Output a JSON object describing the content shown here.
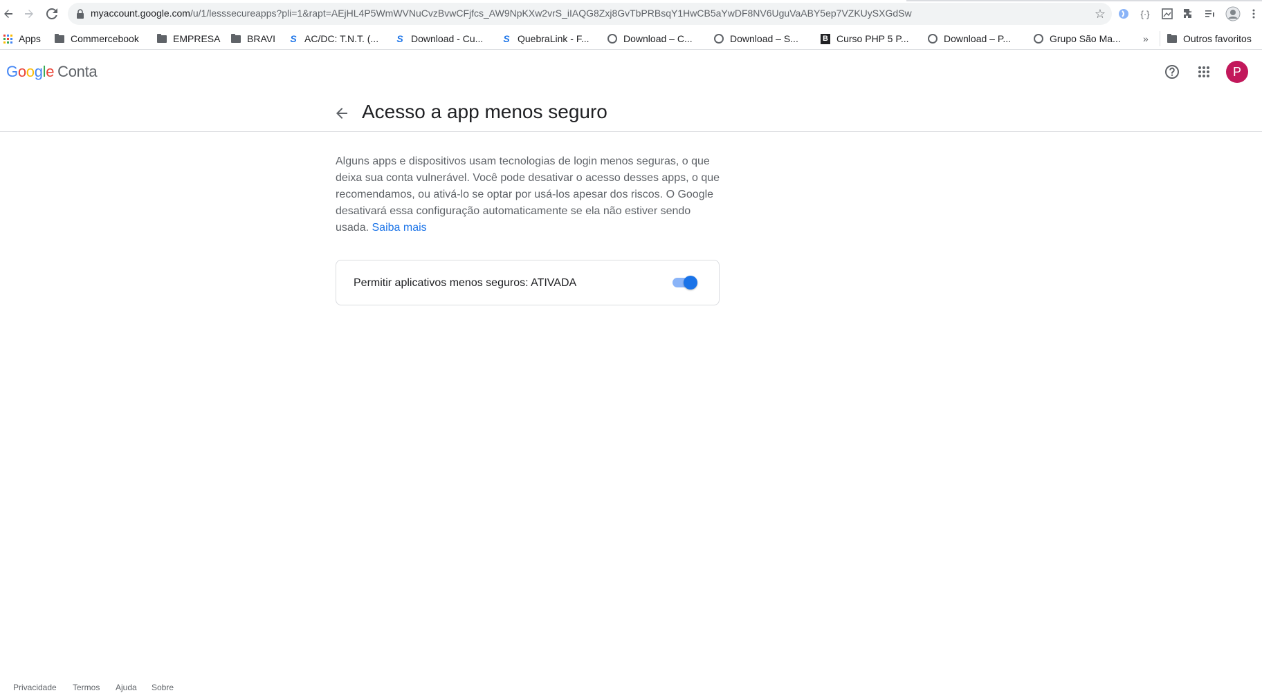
{
  "browser": {
    "url_host": "myaccount.google.com",
    "url_path": "/u/1/lesssecureapps?pli=1&rapt=AEjHL4P5WmWVNuCvzBvwCFjfcs_AW9NpKXw2vrS_iIAQG8Zxj8GvTbPRBsqY1HwCB5aYwDF8NV6UguVaABY5ep7VZKUySXGdSw"
  },
  "bookmarks": {
    "items": [
      {
        "label": "Apps",
        "icon": "apps-grid-icon"
      },
      {
        "label": "Commercebook",
        "icon": "folder-icon"
      },
      {
        "label": "EMPRESA",
        "icon": "folder-icon"
      },
      {
        "label": "BRAVI",
        "icon": "folder-icon"
      },
      {
        "label": "AC/DC: T.N.T. (...",
        "icon": "s-site-icon"
      },
      {
        "label": "Download - Cu...",
        "icon": "s-site-icon"
      },
      {
        "label": "QuebraLink - F...",
        "icon": "s-site-icon"
      },
      {
        "label": "Download – C...",
        "icon": "globe-icon"
      },
      {
        "label": "Download – S...",
        "icon": "globe-icon"
      },
      {
        "label": "Curso PHP 5 P...",
        "icon": "b-site-icon"
      },
      {
        "label": "Download – P...",
        "icon": "globe-icon"
      },
      {
        "label": "Grupo São Ma...",
        "icon": "globe-icon"
      }
    ],
    "overflow": "»",
    "other": "Outros favoritos"
  },
  "header": {
    "logo_letters": [
      "G",
      "o",
      "o",
      "g",
      "l",
      "e"
    ],
    "product": "Conta",
    "avatar_letter": "P"
  },
  "page": {
    "title": "Acesso a app menos seguro",
    "description": "Alguns apps e dispositivos usam tecnologias de login menos seguras, o que deixa sua conta vulnerável. Você pode desativar o acesso desses apps, o que recomendamos, ou ativá-lo se optar por usá-los apesar dos riscos. O Google desativará essa configuração automaticamente se ela não estiver sendo usada.",
    "learn_more": "Saiba mais",
    "setting_label": "Permitir aplicativos menos seguros: ATIVADA",
    "setting_on": true
  },
  "footer": {
    "privacy": "Privacidade",
    "terms": "Termos",
    "help": "Ajuda",
    "about": "Sobre"
  },
  "colors": {
    "accent": "#1a73e8",
    "avatar": "#c2185b"
  }
}
